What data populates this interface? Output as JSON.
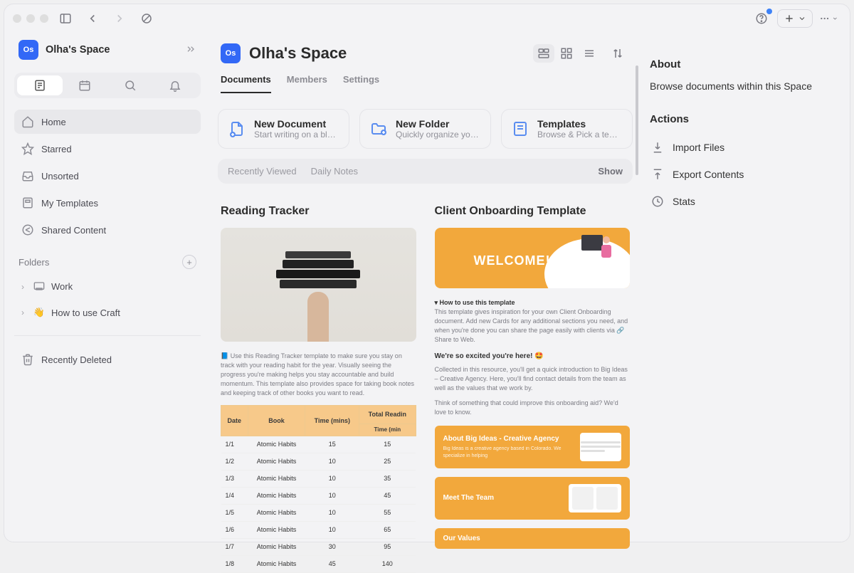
{
  "titlebar": {
    "helpBadge": true
  },
  "sidebar": {
    "spaceInitials": "Os",
    "spaceName": "Olha's Space",
    "nav": [
      {
        "label": "Home",
        "key": "home",
        "active": true
      },
      {
        "label": "Starred",
        "key": "starred"
      },
      {
        "label": "Unsorted",
        "key": "unsorted"
      },
      {
        "label": "My Templates",
        "key": "templates"
      },
      {
        "label": "Shared Content",
        "key": "shared"
      }
    ],
    "foldersHeader": "Folders",
    "folders": [
      {
        "icon": "🖥️",
        "label": "Work"
      },
      {
        "icon": "👋",
        "label": "How to use Craft"
      }
    ],
    "recentlyDeleted": "Recently Deleted"
  },
  "page": {
    "chip": "Os",
    "title": "Olha's Space",
    "tabs": [
      {
        "label": "Documents",
        "active": true
      },
      {
        "label": "Members"
      },
      {
        "label": "Settings"
      }
    ]
  },
  "cards": [
    {
      "title": "New Document",
      "sub": "Start writing on a bl…"
    },
    {
      "title": "New Folder",
      "sub": "Quickly organize yo…"
    },
    {
      "title": "Templates",
      "sub": "Browse & Pick a te…"
    }
  ],
  "filter": {
    "recently": "Recently Viewed",
    "daily": "Daily Notes",
    "show": "Show"
  },
  "docs": {
    "readingTracker": {
      "title": "Reading Tracker",
      "intro": "📘 Use this Reading Tracker template to make sure you stay on track with your reading habit for the year. Visually seeing the progress you're making helps you stay accountable and build momentum. This template also provides space for taking book notes and keeping track of other books you want to read.",
      "headers": {
        "date": "Date",
        "book": "Book",
        "time": "Time (mins)",
        "total": "Total Readin",
        "totalSub": "Time  (min"
      },
      "rows": [
        {
          "d": "1/1",
          "b": "Atomic Habits",
          "t": "15",
          "tot": "15"
        },
        {
          "d": "1/2",
          "b": "Atomic Habits",
          "t": "10",
          "tot": "25"
        },
        {
          "d": "1/3",
          "b": "Atomic Habits",
          "t": "10",
          "tot": "35"
        },
        {
          "d": "1/4",
          "b": "Atomic Habits",
          "t": "10",
          "tot": "45"
        },
        {
          "d": "1/5",
          "b": "Atomic Habits",
          "t": "10",
          "tot": "55"
        },
        {
          "d": "1/6",
          "b": "Atomic Habits",
          "t": "10",
          "tot": "65"
        },
        {
          "d": "1/7",
          "b": "Atomic Habits",
          "t": "30",
          "tot": "95"
        },
        {
          "d": "1/8",
          "b": "Atomic Habits",
          "t": "45",
          "tot": "140"
        }
      ]
    },
    "onboarding": {
      "title": "Client Onboarding Template",
      "welcome": "WELCOME!",
      "howtoTitle": "How to use this template",
      "howtoText": "This template gives inspiration for your own Client Onboarding document. Add new Cards for any additional sections you need, and when you're done you can share the page easily with clients via 🔗 Share to Web.",
      "excited": "We're so excited you're here! 🤩",
      "intro": "Collected in this resource, you'll get a quick introduction to Big Ideas – Creative Agency. Here, you'll find contact details from the team as well as the values that we work by.",
      "feedback": "Think of something that could improve this onboarding aid? We'd love to know.",
      "blocks": {
        "about": "About Big Ideas - Creative Agency",
        "aboutSub": "Big Ideas is a creative agency based in Colorado. We specialize in helping",
        "team": "Meet The Team",
        "values": "Our Values"
      }
    }
  },
  "rpanel": {
    "aboutTitle": "About",
    "aboutDesc": "Browse documents within this Space",
    "actionsTitle": "Actions",
    "actions": [
      {
        "label": "Import Files",
        "key": "import"
      },
      {
        "label": "Export Contents",
        "key": "export"
      },
      {
        "label": "Stats",
        "key": "stats"
      }
    ]
  }
}
